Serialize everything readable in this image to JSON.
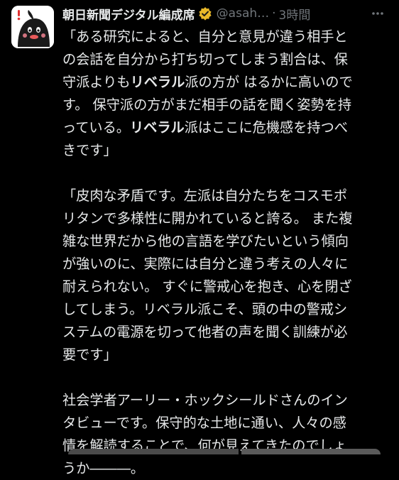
{
  "post": {
    "display_name": "朝日新聞デジタル編成席",
    "handle": "@asah…",
    "separator": "·",
    "time": "3時間",
    "avatar_icon": "mascot-icon",
    "verified_icon": "verified-badge-icon",
    "more_icon": "more-icon",
    "colors": {
      "background": "#000000",
      "text": "#e7e9ea",
      "muted": "#71767b",
      "badge": "#e8b829"
    },
    "paragraphs": [
      [
        [
          {
            "t": "「ある研究によると、自分と意見が違う相手と"
          }
        ],
        [
          {
            "t": "の会話を自分から打ち切ってしまう割合は、保"
          }
        ],
        [
          {
            "t": "守派よりも"
          },
          {
            "t": "リベラル",
            "b": true
          },
          {
            "t": "派の方が はるかに高いので"
          }
        ],
        [
          {
            "t": "す。 保守派の方がまだ相手の話を聞く姿勢を持"
          }
        ],
        [
          {
            "t": "っている。"
          },
          {
            "t": "リベラル",
            "b": true
          },
          {
            "t": "派はここに危機感を持つべ"
          }
        ],
        [
          {
            "t": "きです」"
          }
        ]
      ],
      [
        [
          {
            "t": "「皮肉な矛盾です。左派は自分たちをコスモポ"
          }
        ],
        [
          {
            "t": "リタンで多様性に開かれていると誇る。 また複"
          }
        ],
        [
          {
            "t": "雑な世界だから他の言語を学びたいという傾向"
          }
        ],
        [
          {
            "t": "が強いのに、実際には自分と違う考えの人々に"
          }
        ],
        [
          {
            "t": "耐えられない。 すぐに警戒心を抱き、心を閉ざ"
          }
        ],
        [
          {
            "t": "してしまう。リベラル派こそ、頭の中の警戒シ"
          }
        ],
        [
          {
            "t": "ステムの電源を切って他者の声を聞く訓練が必"
          }
        ],
        [
          {
            "t": "要です」"
          }
        ]
      ],
      [
        [
          {
            "t": "社会学者アーリー・ホックシールドさんのイン"
          }
        ],
        [
          {
            "t": "タビューです。保守的な土地に通い、人々の感"
          }
        ],
        [
          {
            "t": "情を解読することで、何が見えてきたのでしょ"
          }
        ],
        [
          {
            "t": "うか―――。"
          }
        ]
      ]
    ]
  }
}
